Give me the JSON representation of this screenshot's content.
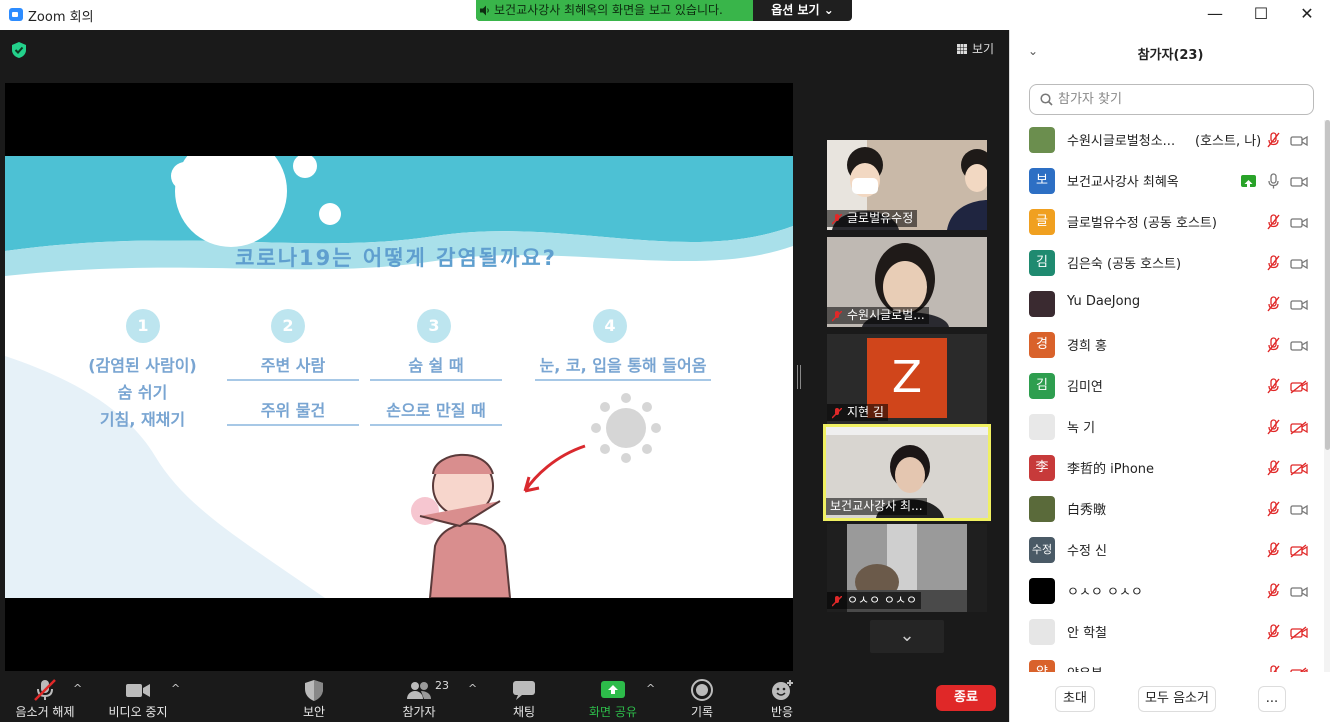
{
  "window": {
    "title": "Zoom 회의",
    "minimize": "—",
    "maximize": "☐",
    "close": "✕"
  },
  "share_banner": {
    "message": "보건교사강사 최혜옥의 화면을 보고 있습니다.",
    "options": "옵션 보기 ⌄"
  },
  "view_button": {
    "label": "보기"
  },
  "slide": {
    "title": "코로나19는 어떻게 감염될까요?",
    "steps": [
      {
        "num": "1",
        "lines": [
          "(감염된 사람이)",
          "숨 쉬기",
          "기침, 재채기"
        ]
      },
      {
        "num": "2",
        "lines": [
          "주변 사람",
          "주위 물건"
        ]
      },
      {
        "num": "3",
        "lines": [
          "숨 쉴 때",
          "손으로 만질 때"
        ]
      },
      {
        "num": "4",
        "lines": [
          "눈, 코, 입을 통해 들어옴"
        ]
      }
    ]
  },
  "video_tiles": [
    {
      "name": "글로벌유수정",
      "muted": true
    },
    {
      "name": "수원시글로벌...",
      "muted": true
    },
    {
      "name": "지현 김",
      "muted": true,
      "initial": "Z"
    },
    {
      "name": "보건교사강사 최...",
      "muted": false,
      "active": true
    },
    {
      "name": "ㅇㅅㅇ ㅇㅅㅇ",
      "muted": true
    }
  ],
  "toolbar": {
    "unmute": "음소거 해제",
    "stop_video": "비디오 중지",
    "security": "보안",
    "participants": "참가자",
    "participants_count": "23",
    "chat": "채팅",
    "share_screen": "화면 공유",
    "record": "기록",
    "reactions": "반응",
    "end": "종료"
  },
  "panel": {
    "title": "참가자(23)",
    "search_placeholder": "참가자 찾기",
    "participants": [
      {
        "name": "수원시글로벌청소...",
        "role": "(호스트, 나)",
        "avatar": "img",
        "color": "#6b8e4e",
        "mic": "muted",
        "cam": "on"
      },
      {
        "name": "보건교사강사 최혜옥",
        "role": "",
        "avatar": "보",
        "color": "#2d6fc4",
        "mic": "on",
        "cam": "on",
        "sharing": true
      },
      {
        "name": "글로벌유수정 (공동 호스트)",
        "role": "",
        "avatar": "글",
        "color": "#f0a020",
        "mic": "muted",
        "cam": "on"
      },
      {
        "name": "김은숙 (공동 호스트)",
        "role": "",
        "avatar": "김",
        "color": "#1f8a70",
        "mic": "muted",
        "cam": "on"
      },
      {
        "name": "Yu DaeJong",
        "role": "",
        "avatar": "img",
        "color": "#3a2a30",
        "mic": "muted",
        "cam": "on"
      },
      {
        "name": "경희 홍",
        "role": "",
        "avatar": "경",
        "color": "#d9622b",
        "mic": "muted",
        "cam": "on"
      },
      {
        "name": "김미연",
        "role": "",
        "avatar": "김",
        "color": "#2e9e4f",
        "mic": "muted",
        "cam": "off"
      },
      {
        "name": "녹 기",
        "role": "",
        "avatar": "img",
        "color": "#e8e8e8",
        "mic": "muted",
        "cam": "off"
      },
      {
        "name": "李哲的 iPhone",
        "role": "",
        "avatar": "李",
        "color": "#c73a3a",
        "mic": "muted",
        "cam": "off"
      },
      {
        "name": "白秀暾",
        "role": "",
        "avatar": "img",
        "color": "#5a6a3a",
        "mic": "muted",
        "cam": "on"
      },
      {
        "name": "수정 신",
        "role": "",
        "avatar": "수정",
        "color": "#4a5a66",
        "mic": "muted",
        "cam": "off"
      },
      {
        "name": "ㅇㅅㅇ ㅇㅅㅇ",
        "role": "",
        "avatar": "",
        "color": "#000000",
        "mic": "muted",
        "cam": "on"
      },
      {
        "name": "안 학철",
        "role": "",
        "avatar": "img",
        "color": "#e6e6e6",
        "mic": "muted",
        "cam": "off"
      },
      {
        "name": "양은봉",
        "role": "",
        "avatar": "양",
        "color": "#d9622b",
        "mic": "muted",
        "cam": "off"
      }
    ],
    "footer": {
      "invite": "초대",
      "mute_all": "모두 음소거",
      "more": "..."
    }
  },
  "colors": {
    "banner_green": "#39b54a",
    "end_red": "#e02828",
    "active_tile": "#f0f062",
    "muted_red": "#e02828"
  }
}
